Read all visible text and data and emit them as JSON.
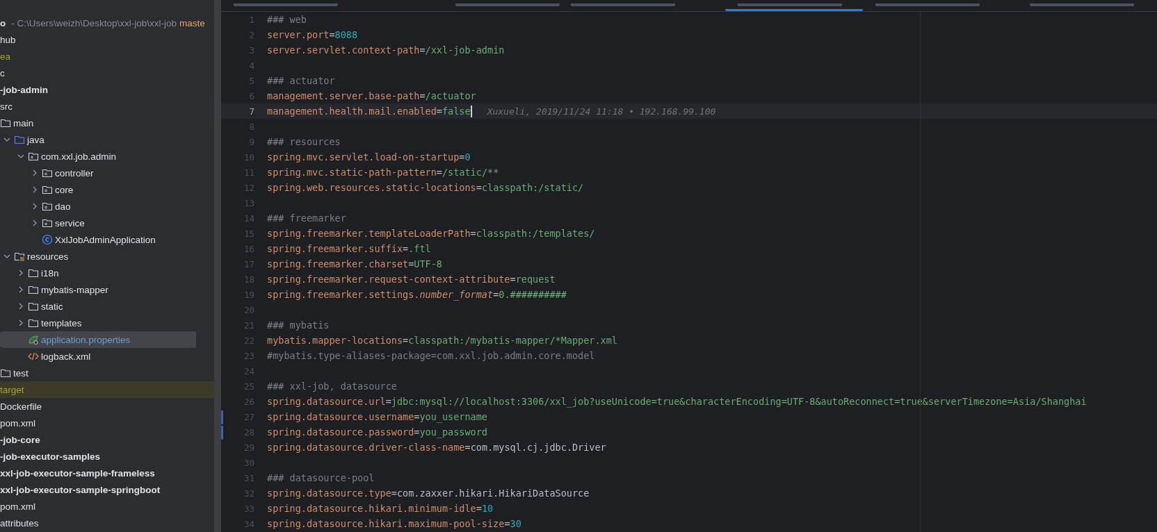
{
  "tabs": [
    {
      "selected": false
    },
    {
      "selected": false
    },
    {
      "selected": false
    },
    {
      "selected": true
    },
    {
      "selected": false
    },
    {
      "selected": false
    }
  ],
  "project_tree": {
    "header": {
      "project": "o",
      "path": "- C:\\Users\\weizh\\Desktop\\xxl-job\\xxl-job",
      "branch": "maste"
    },
    "items": [
      {
        "label": "hub",
        "selected": false
      },
      {
        "label": "ea",
        "ignored": true,
        "selected": false
      },
      {
        "label": "c",
        "selected": false
      },
      {
        "label": "-job-admin",
        "module": true,
        "selected": false,
        "children": [
          {
            "label": "src",
            "selected": false,
            "children": [
              {
                "label": "main",
                "kind": "folder",
                "selected": false,
                "children": [
                  {
                    "label": "java",
                    "kind": "source-folder",
                    "expanded": true,
                    "selected": false,
                    "children": [
                      {
                        "label": "com.xxl.job.admin",
                        "kind": "package",
                        "expanded": true,
                        "selected": false,
                        "children": [
                          {
                            "label": "controller",
                            "kind": "package",
                            "expanded": false,
                            "selected": false
                          },
                          {
                            "label": "core",
                            "kind": "package",
                            "expanded": false,
                            "selected": false
                          },
                          {
                            "label": "dao",
                            "kind": "package",
                            "expanded": false,
                            "selected": false
                          },
                          {
                            "label": "service",
                            "kind": "package",
                            "expanded": false,
                            "selected": false
                          },
                          {
                            "label": "XxlJobAdminApplication",
                            "kind": "class",
                            "selected": false
                          }
                        ]
                      }
                    ]
                  },
                  {
                    "label": "resources",
                    "kind": "resources-folder",
                    "expanded": true,
                    "selected": false,
                    "children": [
                      {
                        "label": "i18n",
                        "kind": "folder",
                        "expanded": false,
                        "selected": false
                      },
                      {
                        "label": "mybatis-mapper",
                        "kind": "folder",
                        "expanded": false,
                        "selected": false
                      },
                      {
                        "label": "static",
                        "kind": "folder",
                        "expanded": false,
                        "selected": false
                      },
                      {
                        "label": "templates",
                        "kind": "folder",
                        "expanded": false,
                        "selected": false
                      },
                      {
                        "label": "application.properties",
                        "kind": "properties",
                        "modified": true,
                        "selected": true
                      },
                      {
                        "label": "logback.xml",
                        "kind": "xml",
                        "selected": false
                      }
                    ]
                  }
                ]
              },
              {
                "label": "test",
                "kind": "folder",
                "selected": false
              }
            ]
          },
          {
            "label": "target",
            "excluded": true,
            "selected": false
          },
          {
            "label": "Dockerfile",
            "selected": false
          },
          {
            "label": "pom.xml",
            "selected": false
          }
        ]
      },
      {
        "label": "-job-core",
        "module": true,
        "selected": false
      },
      {
        "label": "-job-executor-samples",
        "module": true,
        "selected": false,
        "children": [
          {
            "label": "xxl-job-executor-sample-frameless",
            "module": true,
            "selected": false
          },
          {
            "label": "xxl-job-executor-sample-springboot",
            "module": true,
            "selected": false
          },
          {
            "label": "pom.xml",
            "selected": false
          }
        ]
      },
      {
        "label": "attributes",
        "selected": false
      }
    ]
  },
  "editor": {
    "lines": [
      {
        "number": "1",
        "current": false,
        "changed": false,
        "tokens": [
          {
            "kind": "comment",
            "text": "### web"
          }
        ]
      },
      {
        "number": "2",
        "current": false,
        "changed": false,
        "tokens": [
          {
            "kind": "key",
            "text": "server.port"
          },
          {
            "kind": "eq",
            "text": "="
          },
          {
            "kind": "number",
            "text": "8088"
          }
        ]
      },
      {
        "number": "3",
        "current": false,
        "changed": false,
        "tokens": [
          {
            "kind": "key",
            "text": "server.servlet.context-path"
          },
          {
            "kind": "eq",
            "text": "="
          },
          {
            "kind": "string",
            "text": "/xxl-job-admin"
          }
        ]
      },
      {
        "number": "4",
        "current": false,
        "changed": false
      },
      {
        "number": "5",
        "current": false,
        "changed": false,
        "tokens": [
          {
            "kind": "comment",
            "text": "### actuator"
          }
        ]
      },
      {
        "number": "6",
        "current": false,
        "changed": false,
        "tokens": [
          {
            "kind": "key",
            "text": "management.server.base-path"
          },
          {
            "kind": "eq",
            "text": "="
          },
          {
            "kind": "string",
            "text": "/actuator"
          }
        ]
      },
      {
        "number": "7",
        "current": true,
        "changed": false,
        "tokens": [
          {
            "kind": "key",
            "text": "management.health.mail.enabled"
          },
          {
            "kind": "eq",
            "text": "="
          },
          {
            "kind": "string",
            "text": "false"
          }
        ],
        "blame": "Xuxueli, 2019/11/24 11:18 • 192.168.99.100"
      },
      {
        "number": "8",
        "current": false,
        "changed": false
      },
      {
        "number": "9",
        "current": false,
        "changed": false,
        "tokens": [
          {
            "kind": "comment",
            "text": "### resources"
          }
        ]
      },
      {
        "number": "10",
        "current": false,
        "changed": false,
        "tokens": [
          {
            "kind": "key",
            "text": "spring.mvc.servlet.load-on-startup"
          },
          {
            "kind": "eq",
            "text": "="
          },
          {
            "kind": "number",
            "text": "0"
          }
        ]
      },
      {
        "number": "11",
        "current": false,
        "changed": false,
        "tokens": [
          {
            "kind": "key",
            "text": "spring.mvc.static-path-pattern"
          },
          {
            "kind": "eq",
            "text": "="
          },
          {
            "kind": "string",
            "text": "/static/**"
          }
        ]
      },
      {
        "number": "12",
        "current": false,
        "changed": false,
        "tokens": [
          {
            "kind": "key",
            "text": "spring.web.resources.static-locations"
          },
          {
            "kind": "eq",
            "text": "="
          },
          {
            "kind": "string",
            "text": "classpath:/static/"
          }
        ]
      },
      {
        "number": "13",
        "current": false,
        "changed": false
      },
      {
        "number": "14",
        "current": false,
        "changed": false,
        "tokens": [
          {
            "kind": "comment",
            "text": "### freemarker"
          }
        ]
      },
      {
        "number": "15",
        "current": false,
        "changed": false,
        "tokens": [
          {
            "kind": "key",
            "text": "spring.freemarker.templateLoaderPath"
          },
          {
            "kind": "eq",
            "text": "="
          },
          {
            "kind": "string",
            "text": "classpath:/templates/"
          }
        ]
      },
      {
        "number": "16",
        "current": false,
        "changed": false,
        "tokens": [
          {
            "kind": "key",
            "text": "spring.freemarker.suffix"
          },
          {
            "kind": "eq",
            "text": "="
          },
          {
            "kind": "string",
            "text": ".ftl"
          }
        ]
      },
      {
        "number": "17",
        "current": false,
        "changed": false,
        "tokens": [
          {
            "kind": "key",
            "text": "spring.freemarker.charset"
          },
          {
            "kind": "eq",
            "text": "="
          },
          {
            "kind": "string",
            "text": "UTF-8"
          }
        ]
      },
      {
        "number": "18",
        "current": false,
        "changed": false,
        "tokens": [
          {
            "kind": "key",
            "text": "spring.freemarker.request-context-attribute"
          },
          {
            "kind": "eq",
            "text": "="
          },
          {
            "kind": "string",
            "text": "request"
          }
        ]
      },
      {
        "number": "19",
        "current": false,
        "changed": false,
        "tokens": [
          {
            "kind": "key",
            "text": "spring.freemarker.settings."
          },
          {
            "kind": "key-italic",
            "text": "number_format"
          },
          {
            "kind": "eq",
            "text": "="
          },
          {
            "kind": "string",
            "text": "0.##########"
          }
        ]
      },
      {
        "number": "20",
        "current": false,
        "changed": false
      },
      {
        "number": "21",
        "current": false,
        "changed": false,
        "tokens": [
          {
            "kind": "comment",
            "text": "### mybatis"
          }
        ]
      },
      {
        "number": "22",
        "current": false,
        "changed": false,
        "tokens": [
          {
            "kind": "key",
            "text": "mybatis.mapper-locations"
          },
          {
            "kind": "eq",
            "text": "="
          },
          {
            "kind": "string",
            "text": "classpath:/mybatis-mapper/*Mapper.xml"
          }
        ]
      },
      {
        "number": "23",
        "current": false,
        "changed": false,
        "tokens": [
          {
            "kind": "comment",
            "text": "#mybatis.type-aliases-package=com.xxl.job.admin.core.model"
          }
        ]
      },
      {
        "number": "24",
        "current": false,
        "changed": false
      },
      {
        "number": "25",
        "current": false,
        "changed": false,
        "tokens": [
          {
            "kind": "comment",
            "text": "### xxl-job, datasource"
          }
        ]
      },
      {
        "number": "26",
        "current": false,
        "changed": false,
        "tokens": [
          {
            "kind": "key",
            "text": "spring.datasource.url"
          },
          {
            "kind": "eq",
            "text": "="
          },
          {
            "kind": "string",
            "text": "jdbc:mysql://localhost:3306/xxl_job?useUnicode=true&characterEncoding=UTF-8&autoReconnect=true&serverTimezone=Asia/Shanghai"
          }
        ]
      },
      {
        "number": "27",
        "current": false,
        "changed": true,
        "tokens": [
          {
            "kind": "key",
            "text": "spring.datasource.username"
          },
          {
            "kind": "eq",
            "text": "="
          },
          {
            "kind": "string",
            "text": "you_username"
          }
        ]
      },
      {
        "number": "28",
        "current": false,
        "changed": true,
        "tokens": [
          {
            "kind": "key",
            "text": "spring.datasource.password"
          },
          {
            "kind": "eq",
            "text": "="
          },
          {
            "kind": "string",
            "text": "you_password"
          }
        ]
      },
      {
        "number": "29",
        "current": false,
        "changed": false,
        "tokens": [
          {
            "kind": "key",
            "text": "spring.datasource.driver-class-name"
          },
          {
            "kind": "eq",
            "text": "="
          },
          {
            "kind": "class",
            "text": "com.mysql.cj.jdbc.Driver"
          }
        ]
      },
      {
        "number": "30",
        "current": false,
        "changed": false
      },
      {
        "number": "31",
        "current": false,
        "changed": false,
        "tokens": [
          {
            "kind": "comment",
            "text": "### datasource-pool"
          }
        ]
      },
      {
        "number": "32",
        "current": false,
        "changed": false,
        "tokens": [
          {
            "kind": "key",
            "text": "spring.datasource.type"
          },
          {
            "kind": "eq",
            "text": "="
          },
          {
            "kind": "class",
            "text": "com.zaxxer.hikari.HikariDataSource"
          }
        ]
      },
      {
        "number": "33",
        "current": false,
        "changed": false,
        "tokens": [
          {
            "kind": "key",
            "text": "spring.datasource.hikari.minimum-idle"
          },
          {
            "kind": "eq",
            "text": "="
          },
          {
            "kind": "number",
            "text": "10"
          }
        ]
      },
      {
        "number": "34",
        "current": false,
        "changed": false,
        "tokens": [
          {
            "kind": "key",
            "text": "spring.datasource.hikari.maximum-pool-size"
          },
          {
            "kind": "eq",
            "text": "="
          },
          {
            "kind": "number",
            "text": "30"
          }
        ]
      }
    ]
  }
}
